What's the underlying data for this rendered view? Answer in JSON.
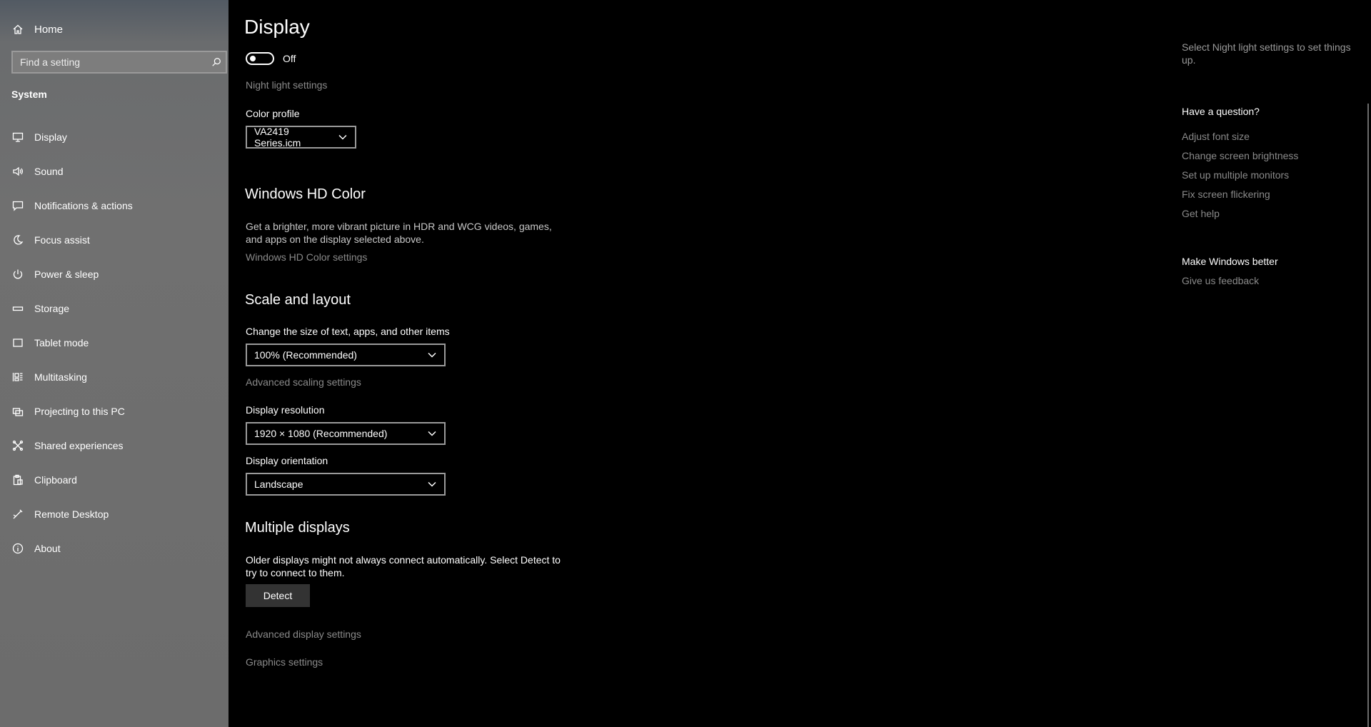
{
  "sidebar": {
    "home_label": "Home",
    "search_placeholder": "Find a setting",
    "section_title": "System",
    "items": [
      {
        "label": "Display",
        "icon": "monitor-icon"
      },
      {
        "label": "Sound",
        "icon": "speaker-icon"
      },
      {
        "label": "Notifications & actions",
        "icon": "message-icon"
      },
      {
        "label": "Focus assist",
        "icon": "moon-icon"
      },
      {
        "label": "Power & sleep",
        "icon": "power-icon"
      },
      {
        "label": "Storage",
        "icon": "storage-icon"
      },
      {
        "label": "Tablet mode",
        "icon": "tablet-icon"
      },
      {
        "label": "Multitasking",
        "icon": "multitasking-icon"
      },
      {
        "label": "Projecting to this PC",
        "icon": "projector-icon"
      },
      {
        "label": "Shared experiences",
        "icon": "shared-icon"
      },
      {
        "label": "Clipboard",
        "icon": "clipboard-icon"
      },
      {
        "label": "Remote Desktop",
        "icon": "remote-desktop-icon"
      },
      {
        "label": "About",
        "icon": "info-icon"
      }
    ]
  },
  "main": {
    "title": "Display",
    "night_light": {
      "toggle_state": "Off",
      "settings_link": "Night light settings"
    },
    "color_profile": {
      "label": "Color profile",
      "value": "VA2419 Series.icm"
    },
    "hd_color": {
      "heading": "Windows HD Color",
      "description_line1": "Get a brighter, more vibrant picture in HDR and WCG videos, games,",
      "description_line2": "and apps on the display selected above.",
      "link": "Windows HD Color settings"
    },
    "scale_layout": {
      "heading": "Scale and layout",
      "scale_label": "Change the size of text, apps, and other items",
      "scale_value": "100% (Recommended)",
      "advanced_scaling_link": "Advanced scaling settings",
      "resolution_label": "Display resolution",
      "resolution_value": "1920 × 1080 (Recommended)",
      "orientation_label": "Display orientation",
      "orientation_value": "Landscape"
    },
    "multiple_displays": {
      "heading": "Multiple displays",
      "description_line1": "Older displays might not always connect automatically. Select Detect to",
      "description_line2": "try to connect to them.",
      "detect_button": "Detect"
    },
    "advanced_display_link": "Advanced display settings",
    "graphics_settings_link": "Graphics settings"
  },
  "right_panel": {
    "top_text_line1": "Select Night light settings to set things",
    "top_text_line2": "up.",
    "question_heading": "Have a question?",
    "help_links": [
      "Adjust font size",
      "Change screen brightness",
      "Set up multiple monitors",
      "Fix screen flickering",
      "Get help"
    ],
    "feedback_heading": "Make Windows better",
    "feedback_link": "Give us feedback"
  }
}
